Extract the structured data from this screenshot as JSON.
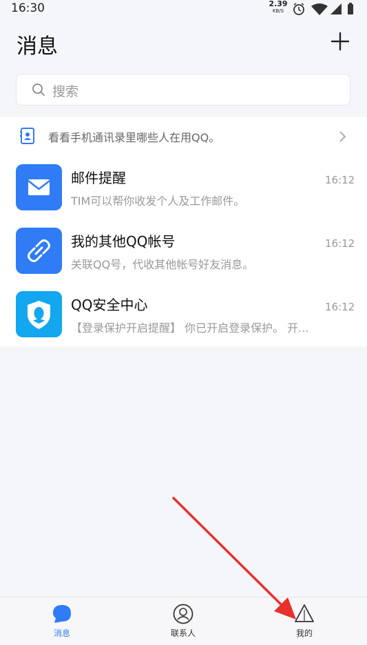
{
  "status_bar": {
    "time": "16:30",
    "net_speed_value": "2.39",
    "net_speed_unit": "KB/S",
    "icons": [
      "alarm-icon",
      "wifi-icon",
      "signal-icon",
      "battery-icon"
    ]
  },
  "header": {
    "title": "消息",
    "add_icon": "plus-icon"
  },
  "search": {
    "placeholder": "搜索",
    "icon": "search-icon"
  },
  "banner": {
    "text": "看看手机通讯录里哪些人在用QQ。",
    "icon": "contact-card-icon"
  },
  "messages": [
    {
      "name": "邮件提醒",
      "preview": "TIM可以帮你收发个人及工作邮件。",
      "time": "16:12",
      "icon": "mail-icon",
      "color": "#2f7cf6"
    },
    {
      "name": "我的其他QQ帐号",
      "preview": "关联QQ号，代收其他帐号好友消息。",
      "time": "16:12",
      "icon": "link-icon",
      "color": "#2f7cf6"
    },
    {
      "name": "QQ安全中心",
      "preview": "【登录保护开启提醒】 你已开启登录保护。 开...",
      "time": "16:12",
      "icon": "shield-icon",
      "color": "#12a7ef"
    }
  ],
  "bottom_nav": [
    {
      "label": "消息",
      "icon": "chat-bubble-icon",
      "active": true
    },
    {
      "label": "联系人",
      "icon": "contacts-icon",
      "active": false
    },
    {
      "label": "我的",
      "icon": "profile-icon",
      "active": false
    }
  ],
  "colors": {
    "accent": "#2f7cf6",
    "background": "#f5f6fa",
    "annotation_arrow": "#e8302c"
  }
}
